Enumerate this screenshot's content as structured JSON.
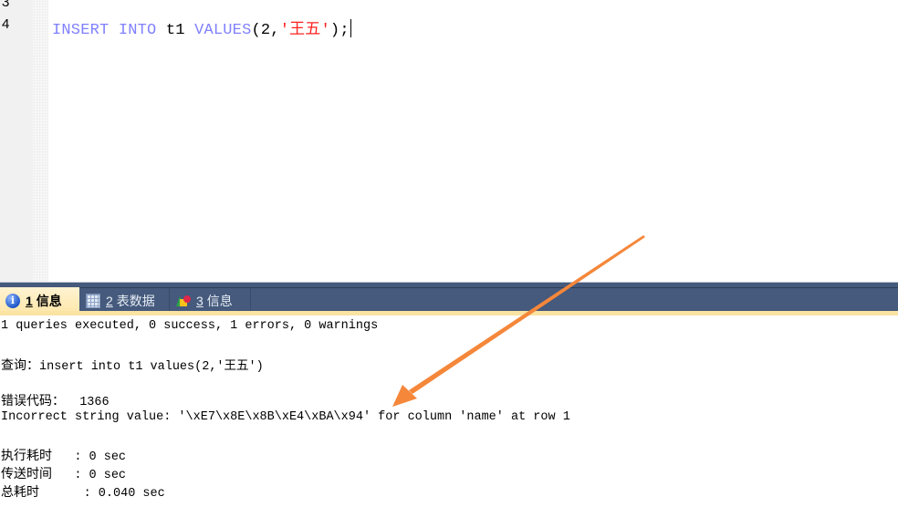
{
  "editor": {
    "line_numbers": [
      "3",
      "4"
    ],
    "code": {
      "kw_insert": "INSERT",
      "kw_into": "INTO",
      "table": "t1",
      "kw_values": "VALUES",
      "open": "(2,",
      "string": "'王五'",
      "close": ");"
    }
  },
  "tabs": [
    {
      "num": "1",
      "label": "信息",
      "icon": "info-icon",
      "active": true
    },
    {
      "num": "2",
      "label": "表数据",
      "icon": "table-grid-icon",
      "active": false
    },
    {
      "num": "3",
      "label": "信息",
      "icon": "shapes-icon",
      "active": false
    }
  ],
  "messages": {
    "summary": "1 queries executed, 0 success, 1 errors, 0 warnings",
    "query_label": "查询：",
    "query_text": "insert into t1 values(2,'王五')",
    "error_code_label": "错误代码：",
    "error_code": "1366",
    "error_message": "Incorrect string value: '\\xE7\\x8E\\x8B\\xE4\\xBA\\x94' for column 'name' at row 1",
    "timings": [
      {
        "label": "执行耗时",
        "value": ": 0 sec"
      },
      {
        "label": "传送时间",
        "value": ": 0 sec"
      },
      {
        "label": "总耗时",
        "value": ": 0.040 sec"
      }
    ]
  },
  "annotation": {
    "arrow_color": "#f5873a"
  }
}
